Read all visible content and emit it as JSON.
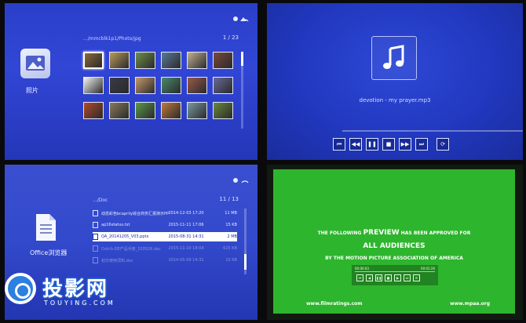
{
  "photos": {
    "app_label": "照片",
    "path": ".../mmcblk1p1/Photo/jpg",
    "page": "1 / 23",
    "status_icons": "wifi-icon",
    "thumb_colors": [
      "#8a6a3a",
      "#b89a5a",
      "#6f8f4a",
      "#5a7a9a",
      "#c0b090",
      "#7a4a3a",
      "#f2f2f2",
      "#3a3a4a",
      "#c49a6a",
      "#4a8a6a",
      "#9a5a4a",
      "#6a6a9a",
      "#b04a2a",
      "#8a7a5a",
      "#5a9a4a",
      "#c07a3a",
      "#7a9aa0",
      "#6a8a3a"
    ],
    "selected_index": 0
  },
  "music": {
    "track": "devotion - my prayer.mp3",
    "progress": 0.0,
    "controls": [
      "skip-back-icon",
      "rewind-icon",
      "pause-icon",
      "stop-icon",
      "forward-icon",
      "skip-forward-icon",
      "repeat-icon"
    ]
  },
  "office": {
    "app_label": "Office浏览器",
    "path": ".../Doc",
    "page": "11 / 13",
    "files": [
      {
        "name": "动态彩色bcaprily综合商务汇报演示PPT模板_.pptx",
        "date": "2014-12-03 17:20",
        "size": "11 MB"
      },
      {
        "name": "ap16status.txt",
        "date": "2015-11-11 17:06",
        "size": "15 KB"
      },
      {
        "name": "QA_20141205_V03.pptx",
        "date": "2015-08-31 14:31",
        "size": "2 MB"
      },
      {
        "name": "Dutch-DE产品手册_150526.doc",
        "date": "2015-11-10 18:04",
        "size": "625 KB"
      },
      {
        "name": "初次使用须知.doc",
        "date": "2014-05-09 14:31",
        "size": "15 KB"
      }
    ],
    "selected_index": 2
  },
  "video": {
    "line1_pre": "THE FOLLOWING",
    "line1_big": "PREVIEW",
    "line1_post": "HAS BEEN APPROVED FOR",
    "line2": "ALL AUDIENCES",
    "line3": "BY THE MOTION PICTURE ASSOCIATION OF AMERICA",
    "time_start": "00:00:03",
    "time_end": "00:01:26",
    "url_left": "www.filmratings.com",
    "url_right": "www.mpaa.org",
    "screen_color": "#2db52d"
  },
  "watermark": {
    "text": "投影网",
    "sub": "TOUYING.COM"
  }
}
